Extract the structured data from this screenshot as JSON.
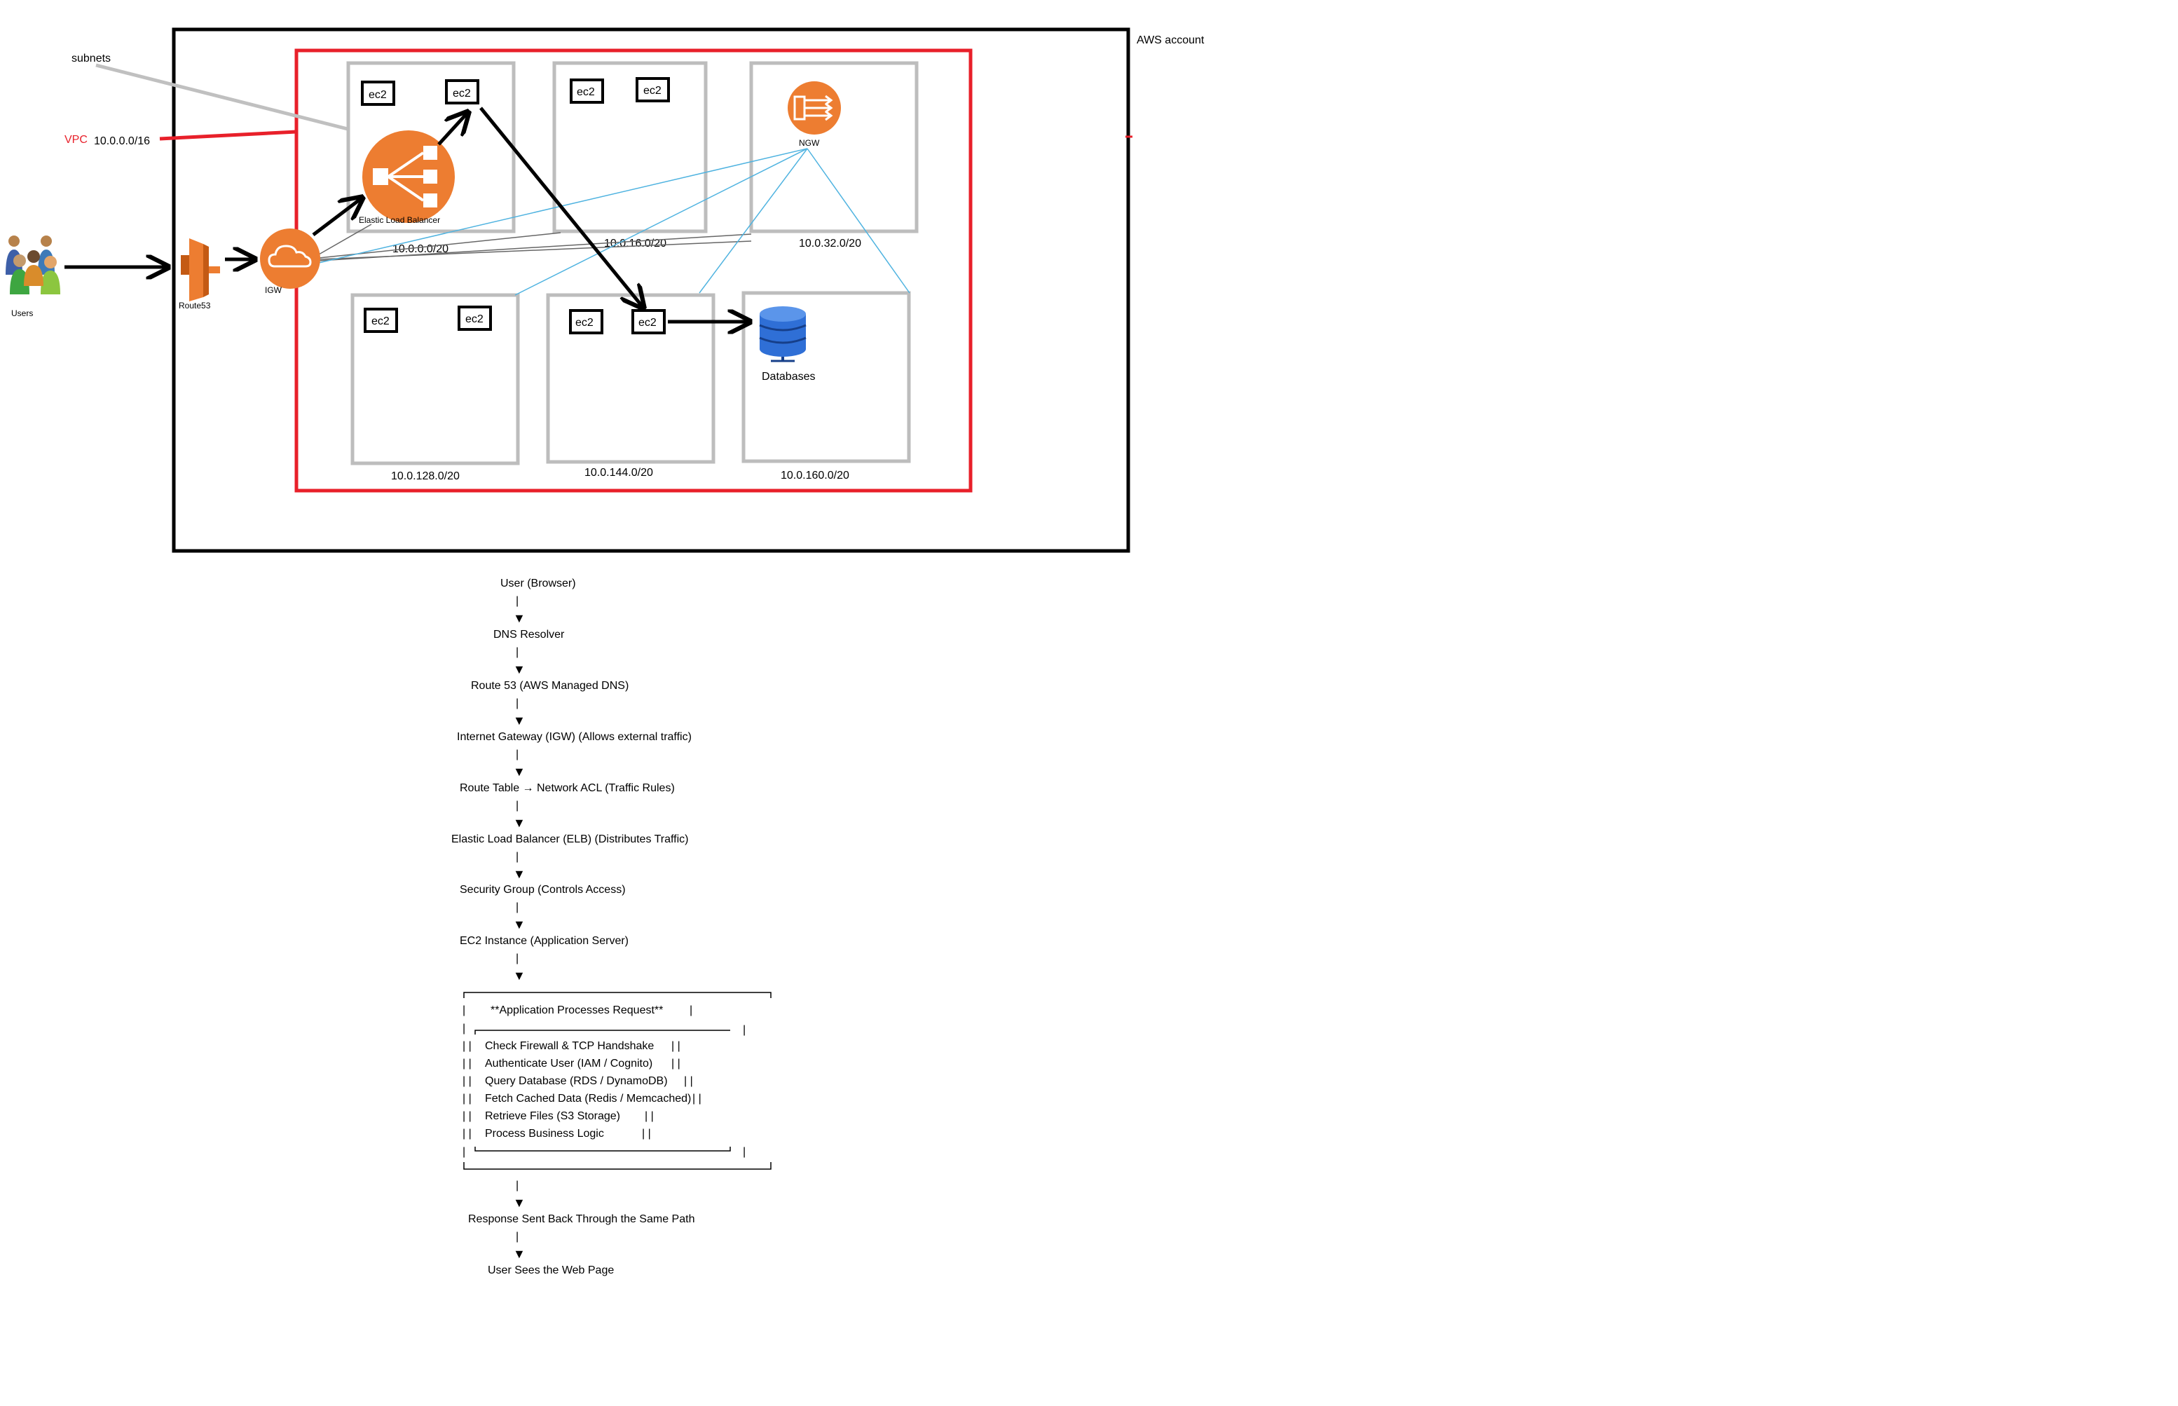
{
  "diagram": {
    "aws_account_label": "AWS account",
    "subnets_label": "subnets",
    "vpc_label": "VPC",
    "vpc_cidr": "10.0.0.0/16",
    "users_label": "Users",
    "route53_label": "Route53",
    "igw_label": "IGW",
    "elb_label": "Elastic Load Balancer",
    "ngw_label": "NGW",
    "databases_label": "Databases",
    "ec2_label": "ec2",
    "subnets": [
      {
        "cidr": "10.0.0.0/20"
      },
      {
        "cidr": "10.0.16.0/20"
      },
      {
        "cidr": "10.0.32.0/20"
      },
      {
        "cidr": "10.0.128.0/20"
      },
      {
        "cidr": "10.0.144.0/20"
      },
      {
        "cidr": "10.0.160.0/20"
      }
    ],
    "colors": {
      "vpc_border": "#e8202a",
      "vpc_text": "#e8202a",
      "subnet_border": "#bdbdbd",
      "aws_orange": "#ed7d31",
      "link_blue": "#4fb3e0",
      "db_blue": "#2f6fd6",
      "subnet_connector_gray": "#c0c0c0"
    }
  },
  "flow": {
    "steps": [
      "User (Browser)",
      "DNS Resolver",
      "Route 53 (AWS Managed DNS)",
      "Internet Gateway (IGW) (Allows external traffic)",
      "Route Table → Network ACL (Traffic Rules)",
      "Elastic Load Balancer (ELB) (Distributes Traffic)",
      "Security Group (Controls Access)",
      "EC2 Instance (Application Server)"
    ],
    "box_title": "**Application Processes Request**",
    "box_items": [
      "Check Firewall & TCP Handshake",
      "Authenticate User (IAM / Cognito)",
      "Query Database (RDS / DynamoDB)",
      "Fetch Cached Data (Redis / Memcached)",
      "Retrieve Files (S3 Storage)",
      "Process Business Logic"
    ],
    "after_steps": [
      "Response Sent Back Through the Same Path",
      "User Sees the Web Page"
    ]
  }
}
